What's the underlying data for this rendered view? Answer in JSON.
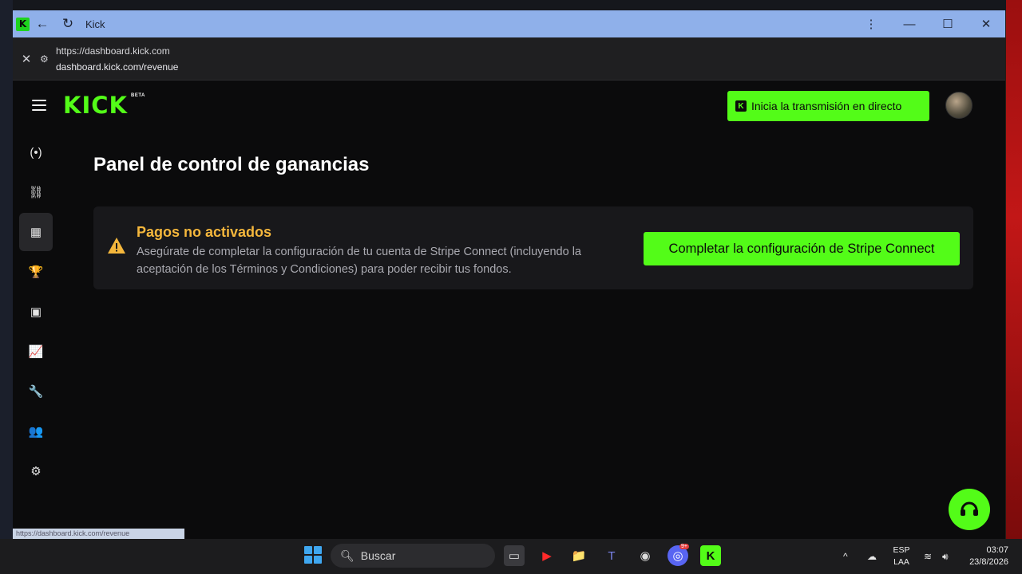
{
  "window": {
    "title": "Kick",
    "url_origin": "https://dashboard.kick.com",
    "url_path": "dashboard.kick.com/revenue",
    "status_url": "https://dashboard.kick.com/revenue"
  },
  "header": {
    "logo": "KICK",
    "beta": "BETA",
    "go_live_label": "Inicia la transmisión en directo"
  },
  "sidebar": {
    "items": [
      {
        "name": "live-icon",
        "glyph": "(•)"
      },
      {
        "name": "link-icon",
        "glyph": "⛓"
      },
      {
        "name": "revenue-icon",
        "glyph": "▦"
      },
      {
        "name": "trophy-icon",
        "glyph": "🏆"
      },
      {
        "name": "video-icon",
        "glyph": "▣"
      },
      {
        "name": "analytics-icon",
        "glyph": "📈"
      },
      {
        "name": "wrench-icon",
        "glyph": "🔧"
      },
      {
        "name": "community-icon",
        "glyph": "👥"
      },
      {
        "name": "settings-icon",
        "glyph": "⚙"
      }
    ]
  },
  "main": {
    "page_title": "Panel de control de ganancias",
    "alert": {
      "title": "Pagos no activados",
      "body": "Asegúrate de completar la configuración de tu cuenta de Stripe Connect (incluyendo la aceptación de los Términos y Condiciones) para poder recibir tus fondos.",
      "button_label": "Completar la configuración de Stripe Connect"
    }
  },
  "taskbar": {
    "search_placeholder": "Buscar",
    "lang_top": "ESP",
    "lang_bottom": "LAA",
    "time": "03:07",
    "date": "23/8/2026",
    "discord_badge": "9+"
  },
  "colors": {
    "accent": "#53fc18",
    "warning": "#f5b73c",
    "titlebar": "#8fb0ea"
  }
}
